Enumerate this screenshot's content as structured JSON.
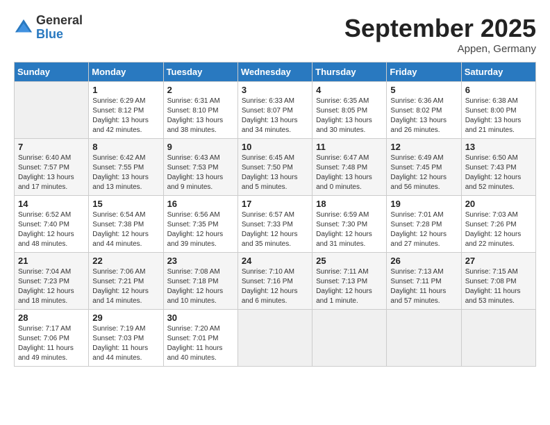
{
  "header": {
    "logo_general": "General",
    "logo_blue": "Blue",
    "month_title": "September 2025",
    "subtitle": "Appen, Germany"
  },
  "weekdays": [
    "Sunday",
    "Monday",
    "Tuesday",
    "Wednesday",
    "Thursday",
    "Friday",
    "Saturday"
  ],
  "weeks": [
    [
      {
        "day": "",
        "empty": true
      },
      {
        "day": "1",
        "sunrise": "Sunrise: 6:29 AM",
        "sunset": "Sunset: 8:12 PM",
        "daylight": "Daylight: 13 hours and 42 minutes."
      },
      {
        "day": "2",
        "sunrise": "Sunrise: 6:31 AM",
        "sunset": "Sunset: 8:10 PM",
        "daylight": "Daylight: 13 hours and 38 minutes."
      },
      {
        "day": "3",
        "sunrise": "Sunrise: 6:33 AM",
        "sunset": "Sunset: 8:07 PM",
        "daylight": "Daylight: 13 hours and 34 minutes."
      },
      {
        "day": "4",
        "sunrise": "Sunrise: 6:35 AM",
        "sunset": "Sunset: 8:05 PM",
        "daylight": "Daylight: 13 hours and 30 minutes."
      },
      {
        "day": "5",
        "sunrise": "Sunrise: 6:36 AM",
        "sunset": "Sunset: 8:02 PM",
        "daylight": "Daylight: 13 hours and 26 minutes."
      },
      {
        "day": "6",
        "sunrise": "Sunrise: 6:38 AM",
        "sunset": "Sunset: 8:00 PM",
        "daylight": "Daylight: 13 hours and 21 minutes."
      }
    ],
    [
      {
        "day": "7",
        "sunrise": "Sunrise: 6:40 AM",
        "sunset": "Sunset: 7:57 PM",
        "daylight": "Daylight: 13 hours and 17 minutes."
      },
      {
        "day": "8",
        "sunrise": "Sunrise: 6:42 AM",
        "sunset": "Sunset: 7:55 PM",
        "daylight": "Daylight: 13 hours and 13 minutes."
      },
      {
        "day": "9",
        "sunrise": "Sunrise: 6:43 AM",
        "sunset": "Sunset: 7:53 PM",
        "daylight": "Daylight: 13 hours and 9 minutes."
      },
      {
        "day": "10",
        "sunrise": "Sunrise: 6:45 AM",
        "sunset": "Sunset: 7:50 PM",
        "daylight": "Daylight: 13 hours and 5 minutes."
      },
      {
        "day": "11",
        "sunrise": "Sunrise: 6:47 AM",
        "sunset": "Sunset: 7:48 PM",
        "daylight": "Daylight: 13 hours and 0 minutes."
      },
      {
        "day": "12",
        "sunrise": "Sunrise: 6:49 AM",
        "sunset": "Sunset: 7:45 PM",
        "daylight": "Daylight: 12 hours and 56 minutes."
      },
      {
        "day": "13",
        "sunrise": "Sunrise: 6:50 AM",
        "sunset": "Sunset: 7:43 PM",
        "daylight": "Daylight: 12 hours and 52 minutes."
      }
    ],
    [
      {
        "day": "14",
        "sunrise": "Sunrise: 6:52 AM",
        "sunset": "Sunset: 7:40 PM",
        "daylight": "Daylight: 12 hours and 48 minutes."
      },
      {
        "day": "15",
        "sunrise": "Sunrise: 6:54 AM",
        "sunset": "Sunset: 7:38 PM",
        "daylight": "Daylight: 12 hours and 44 minutes."
      },
      {
        "day": "16",
        "sunrise": "Sunrise: 6:56 AM",
        "sunset": "Sunset: 7:35 PM",
        "daylight": "Daylight: 12 hours and 39 minutes."
      },
      {
        "day": "17",
        "sunrise": "Sunrise: 6:57 AM",
        "sunset": "Sunset: 7:33 PM",
        "daylight": "Daylight: 12 hours and 35 minutes."
      },
      {
        "day": "18",
        "sunrise": "Sunrise: 6:59 AM",
        "sunset": "Sunset: 7:30 PM",
        "daylight": "Daylight: 12 hours and 31 minutes."
      },
      {
        "day": "19",
        "sunrise": "Sunrise: 7:01 AM",
        "sunset": "Sunset: 7:28 PM",
        "daylight": "Daylight: 12 hours and 27 minutes."
      },
      {
        "day": "20",
        "sunrise": "Sunrise: 7:03 AM",
        "sunset": "Sunset: 7:26 PM",
        "daylight": "Daylight: 12 hours and 22 minutes."
      }
    ],
    [
      {
        "day": "21",
        "sunrise": "Sunrise: 7:04 AM",
        "sunset": "Sunset: 7:23 PM",
        "daylight": "Daylight: 12 hours and 18 minutes."
      },
      {
        "day": "22",
        "sunrise": "Sunrise: 7:06 AM",
        "sunset": "Sunset: 7:21 PM",
        "daylight": "Daylight: 12 hours and 14 minutes."
      },
      {
        "day": "23",
        "sunrise": "Sunrise: 7:08 AM",
        "sunset": "Sunset: 7:18 PM",
        "daylight": "Daylight: 12 hours and 10 minutes."
      },
      {
        "day": "24",
        "sunrise": "Sunrise: 7:10 AM",
        "sunset": "Sunset: 7:16 PM",
        "daylight": "Daylight: 12 hours and 6 minutes."
      },
      {
        "day": "25",
        "sunrise": "Sunrise: 7:11 AM",
        "sunset": "Sunset: 7:13 PM",
        "daylight": "Daylight: 12 hours and 1 minute."
      },
      {
        "day": "26",
        "sunrise": "Sunrise: 7:13 AM",
        "sunset": "Sunset: 7:11 PM",
        "daylight": "Daylight: 11 hours and 57 minutes."
      },
      {
        "day": "27",
        "sunrise": "Sunrise: 7:15 AM",
        "sunset": "Sunset: 7:08 PM",
        "daylight": "Daylight: 11 hours and 53 minutes."
      }
    ],
    [
      {
        "day": "28",
        "sunrise": "Sunrise: 7:17 AM",
        "sunset": "Sunset: 7:06 PM",
        "daylight": "Daylight: 11 hours and 49 minutes."
      },
      {
        "day": "29",
        "sunrise": "Sunrise: 7:19 AM",
        "sunset": "Sunset: 7:03 PM",
        "daylight": "Daylight: 11 hours and 44 minutes."
      },
      {
        "day": "30",
        "sunrise": "Sunrise: 7:20 AM",
        "sunset": "Sunset: 7:01 PM",
        "daylight": "Daylight: 11 hours and 40 minutes."
      },
      {
        "day": "",
        "empty": true
      },
      {
        "day": "",
        "empty": true
      },
      {
        "day": "",
        "empty": true
      },
      {
        "day": "",
        "empty": true
      }
    ]
  ]
}
